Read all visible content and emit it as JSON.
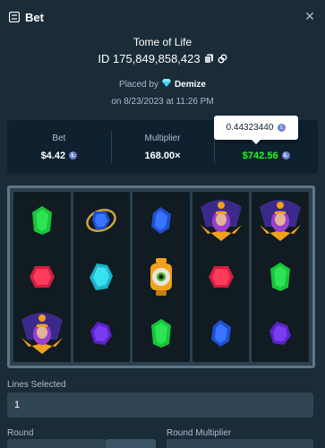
{
  "header": {
    "title": "Bet",
    "close_icon": "close-icon"
  },
  "game": {
    "title": "Tome of Life",
    "id": "ID 175,849,858,423",
    "placed_by_label": "Placed by",
    "username": "Demize",
    "placed_on": "on 8/23/2023 at 11:26 PM"
  },
  "stats": {
    "bet_label": "Bet",
    "bet_value": "$4.42",
    "multiplier_label": "Multiplier",
    "multiplier_value": "168.00×",
    "payout_value": "$742.56"
  },
  "tooltip": {
    "value": "0.44323440"
  },
  "reels": [
    [
      "green-gem",
      "red-gem",
      "skull-pharaoh"
    ],
    [
      "blue-ring-gem",
      "teal-gem",
      "purple-gem"
    ],
    [
      "blue-gem",
      "eye-relic",
      "green-gem"
    ],
    [
      "skull-pharaoh",
      "red-gem",
      "blue-gem"
    ],
    [
      "skull-pharaoh",
      "green-gem",
      "purple-gem"
    ]
  ],
  "form": {
    "lines_label": "Lines Selected",
    "lines_value": "1",
    "round_label": "Round",
    "round_multiplier_label": "Round Multiplier"
  },
  "colors": {
    "background": "#1a2c38",
    "panel": "#0f212e",
    "input": "#2f4553",
    "win_green": "#1fff20",
    "muted": "#b1bad3"
  }
}
